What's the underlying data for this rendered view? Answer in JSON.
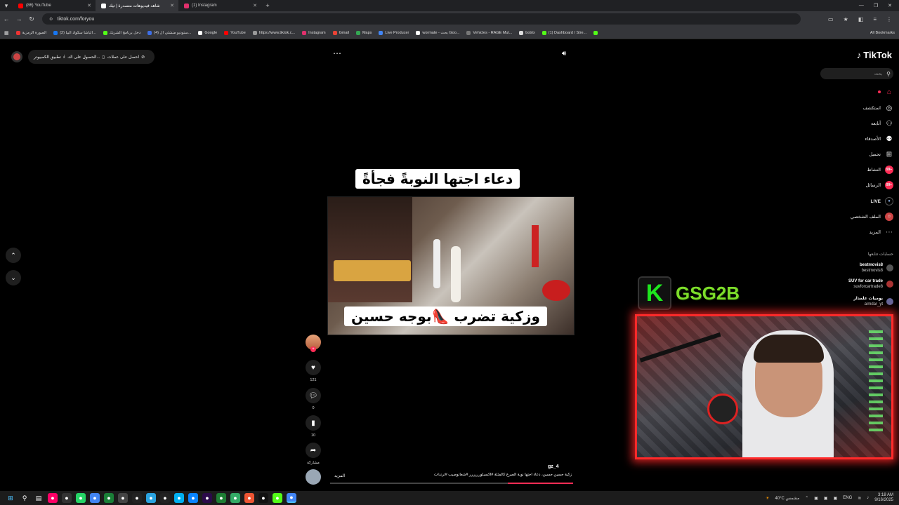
{
  "browser": {
    "tabs": [
      {
        "label": "(86) YouTube",
        "color": "#ff0000"
      },
      {
        "label": "شاهد فيديوهات متصدرة | تيك",
        "color": "#ffffff"
      },
      {
        "label": "(1) Instagram",
        "color": "#e1306c"
      }
    ],
    "url": "tiktok.com/foryou",
    "bookmarks": [
      "الصورة الرمزية",
      "(2) الباشا سكواد البيا...",
      "دخل برنامج الشريك",
      "(4) ستوديو منشئي ال...",
      "Google",
      "YouTube",
      "https://www.tiktok.c...",
      "Instagram",
      "Gmail",
      "Maps",
      "Live Producer",
      "wormate - بحث Goo...",
      "Vehicles - RAGE Mul...",
      "botrix",
      "(1) Dashboard / Stre..."
    ],
    "all_bookmarks": "All Bookmarks"
  },
  "top_bar": {
    "pill_text": "احصل على عملات",
    "get_app": "الحصول على التـ...",
    "desktop_app": "تطبيق الكمبيوتر"
  },
  "tiktok": {
    "logo": "TikTok",
    "search_placeholder": "بحث",
    "nav": [
      {
        "label": "",
        "icon": "home-icon"
      },
      {
        "label": "استكشف",
        "icon": "compass-icon"
      },
      {
        "label": "أتابعه",
        "icon": "following-icon"
      },
      {
        "label": "الأصدقاء",
        "icon": "friends-icon"
      },
      {
        "label": "تحميل",
        "icon": "upload-icon"
      },
      {
        "label": "النشاط",
        "icon": "activity-icon",
        "badge": "99+"
      },
      {
        "label": "الرسائل",
        "icon": "messages-icon",
        "badge": "99+"
      },
      {
        "label": "LIVE",
        "icon": "live-icon"
      },
      {
        "label": "الملف الشخصي",
        "icon": "profile-icon"
      },
      {
        "label": "المزيد",
        "icon": "more-icon"
      }
    ],
    "following_title": "حسابات تتابعها",
    "following": [
      {
        "name": "bestmovis8",
        "handle": "bestmovis8"
      },
      {
        "name": "SUV for car trade",
        "handle": "suvforcartrade8"
      },
      {
        "name": "يوميات علمدار",
        "handle": "almdar_yt"
      }
    ]
  },
  "video": {
    "caption_top": "دعاء اجتها النوبةً فجأةً",
    "caption_bottom": "وزكية تضرب 👠بوجه حسين",
    "likes": "121",
    "comments": "0",
    "saves": "10",
    "share_label": "مشاركة",
    "author": "gz_4",
    "description": "زكية حسين حسين، دعاء أجتها نوبة الصرع كالمثلة #اكسبلورررررر #شعانوصيب #ترندات",
    "more_label": "المزيد"
  },
  "stream": {
    "logo_letter": "K",
    "logo_text": "GSG2B"
  },
  "taskbar": {
    "weather": "40°C مشمس",
    "lang": "ENG",
    "time": "3:18 AM",
    "date": "9/16/2025"
  }
}
